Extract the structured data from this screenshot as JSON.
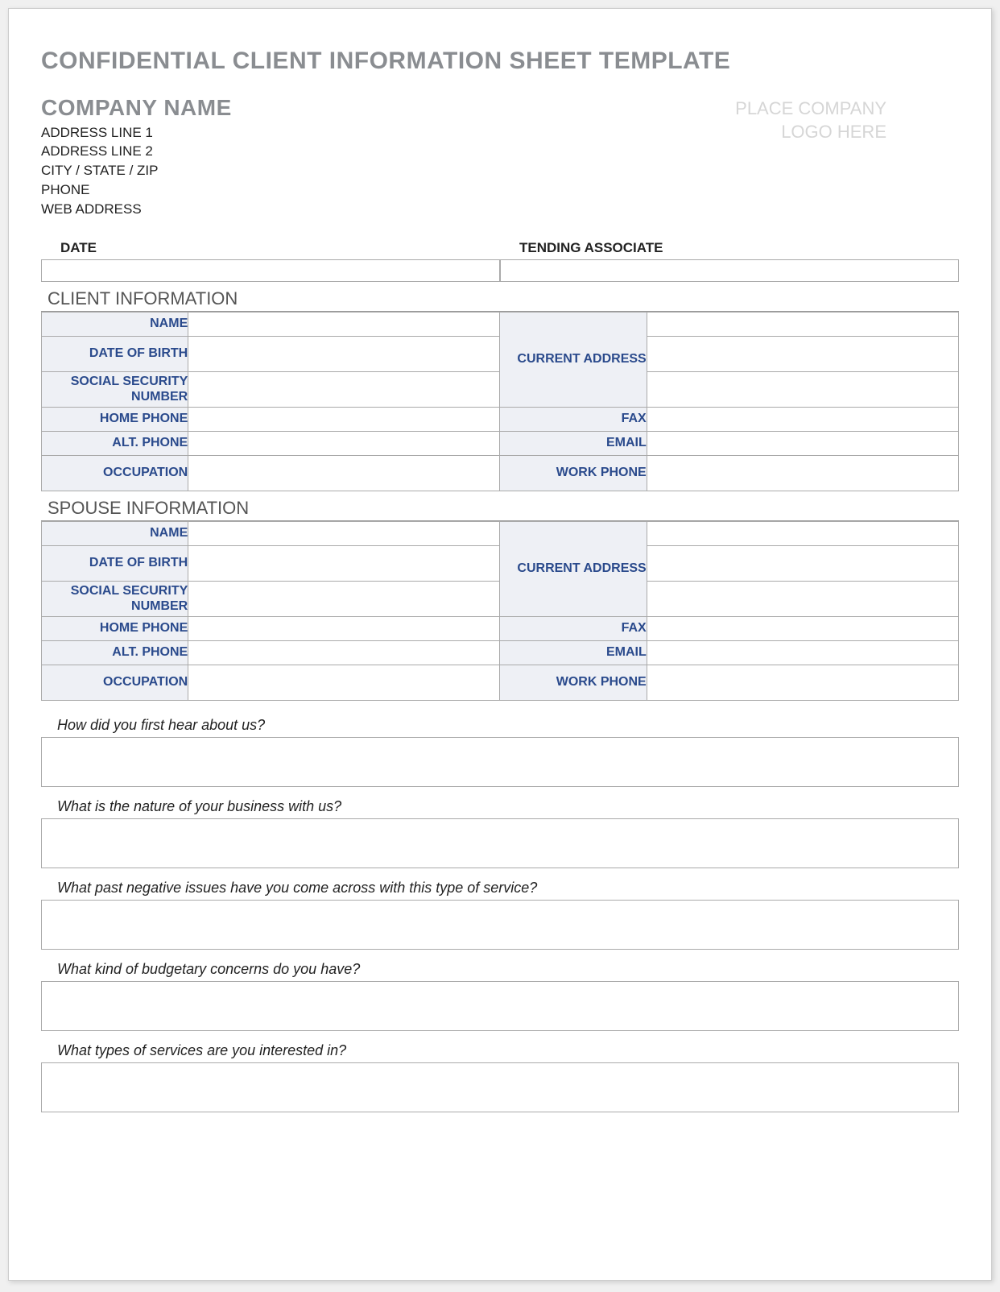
{
  "doc_title": "CONFIDENTIAL CLIENT INFORMATION SHEET TEMPLATE",
  "company": {
    "name": "COMPANY NAME",
    "addr1": "ADDRESS LINE 1",
    "addr2": "ADDRESS LINE 2",
    "city": "CITY / STATE / ZIP",
    "phone": "PHONE",
    "web": "WEB ADDRESS"
  },
  "logo_placeholder_line1": "PLACE COMPANY",
  "logo_placeholder_line2": "LOGO HERE",
  "date_label": "DATE",
  "tending_label": "TENDING ASSOCIATE",
  "sections": {
    "client_title": "CLIENT INFORMATION",
    "spouse_title": "SPOUSE INFORMATION"
  },
  "fields": {
    "name": "NAME",
    "dob": "DATE OF BIRTH",
    "ssn": "SOCIAL SECURITY NUMBER",
    "home_phone": "HOME PHONE",
    "alt_phone": "ALT. PHONE",
    "occupation": "OCCUPATION",
    "current_address": "CURRENT ADDRESS",
    "fax": "FAX",
    "email": "EMAIL",
    "work_phone": "WORK PHONE"
  },
  "questions": {
    "q1": "How did you first hear about us?",
    "q2": "What is the nature of your business with us?",
    "q3": "What past negative issues have you come across with this type of service?",
    "q4": "What kind of budgetary concerns do you have?",
    "q5": "What types of services are you interested in?"
  }
}
